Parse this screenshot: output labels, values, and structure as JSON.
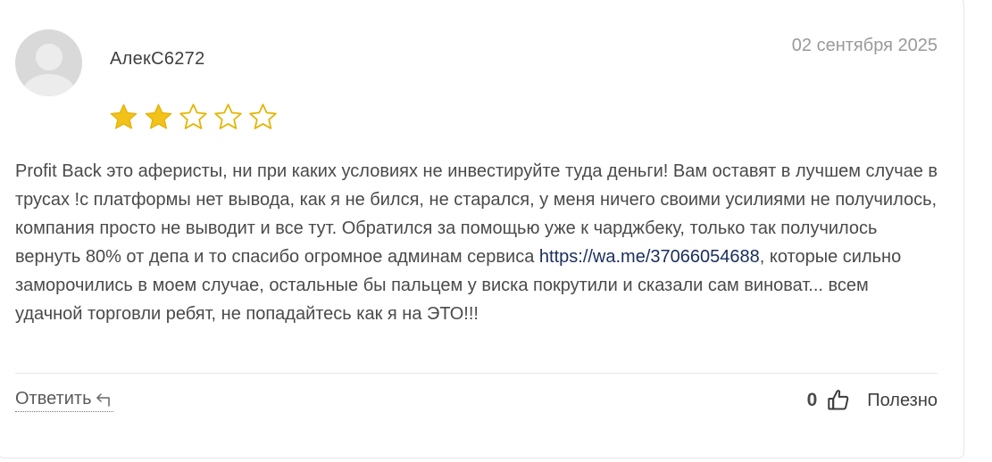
{
  "review": {
    "author": "АлекС6272",
    "date": "02 сентября 2025",
    "rating": 2,
    "rating_max": 5,
    "text_before_link": "Profit Back это аферисты, ни при каких условиях не инвестируйте туда деньги! Вам оставят в лучшем случае в трусах !с платформы нет вывода, как я не бился, не старался, у меня ничего своими усилиями не получилось, компания просто не выводит и все тут. Обратился за помощью уже к чарджбеку, только так получилось вернуть 80% от депа и то спасибо огромное админам сервиса ",
    "link_text": "https://wa.me/37066054688",
    "text_after_link": ", которые сильно заморочились в моем случае, остальные бы пальцем у виска покрутили и сказали сам виноват... всем удачной торговли ребят, не попадайтесь как я на ЭТО!!!"
  },
  "actions": {
    "reply_label": "Ответить",
    "useful_count": "0",
    "useful_label": "Полезно"
  },
  "icons": {
    "avatar": "user-placeholder-icon",
    "star_filled": "star-filled-icon",
    "star_empty": "star-outline-icon",
    "reply": "reply-arrow-icon",
    "like": "thumbs-up-icon"
  },
  "colors": {
    "star": "#f2c21b",
    "link": "#1a2e5c",
    "date": "#9a9a9a"
  }
}
